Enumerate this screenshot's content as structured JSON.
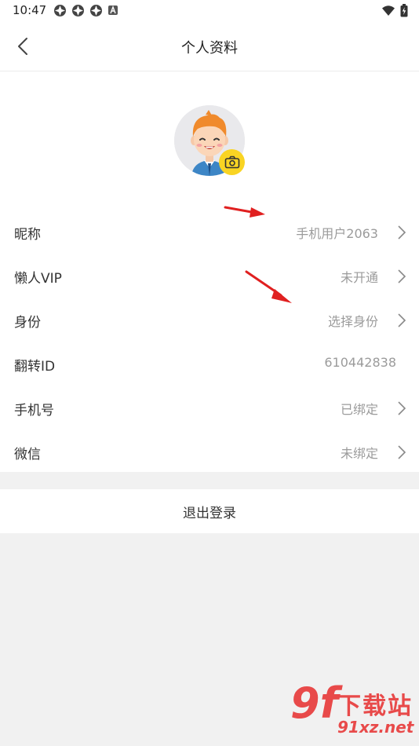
{
  "status_bar": {
    "time": "10:47",
    "icons": [
      "app-icon-1",
      "app-icon-2",
      "app-icon-3",
      "a-icon"
    ],
    "right_icons": [
      "wifi-icon",
      "battery-icon"
    ]
  },
  "header": {
    "title": "个人资料",
    "back_icon": "chevron-left-icon"
  },
  "profile": {
    "avatar_icon": "avatar-cartoon-boy",
    "camera_icon": "camera-icon",
    "camera_color": "#f9d423"
  },
  "rows": [
    {
      "label": "昵称",
      "value": "手机用户2063",
      "chevron": true
    },
    {
      "label": "懒人VIP",
      "value": "未开通",
      "chevron": true
    },
    {
      "label": "身份",
      "value": "选择身份",
      "chevron": true
    },
    {
      "label": "翻转ID",
      "value": "610442838",
      "chevron": false
    },
    {
      "label": "手机号",
      "value": "已绑定",
      "chevron": true
    },
    {
      "label": "微信",
      "value": "未绑定",
      "chevron": true
    }
  ],
  "logout": {
    "label": "退出登录"
  },
  "annotation_color": "#e02020",
  "watermark": {
    "brand": "9f",
    "text": "下载站",
    "url": "91xz.net"
  }
}
